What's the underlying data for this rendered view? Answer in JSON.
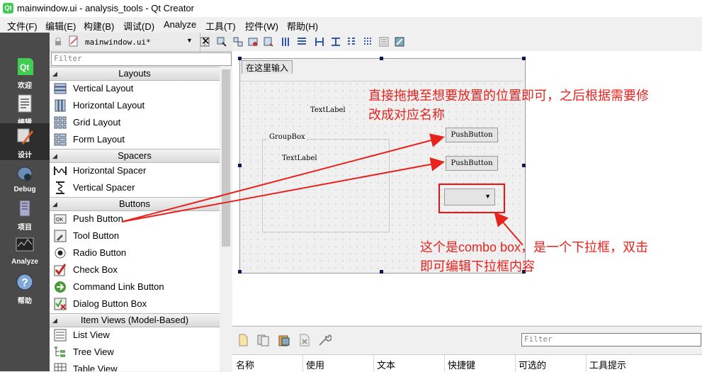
{
  "window": {
    "title": "mainwindow.ui - analysis_tools - Qt Creator",
    "logo_text": "Qt"
  },
  "menubar": [
    {
      "label": "文件(F)"
    },
    {
      "label": "编辑(E)"
    },
    {
      "label": "构建(B)"
    },
    {
      "label": "调试(D)"
    },
    {
      "label": "Analyze"
    },
    {
      "label": "工具(T)"
    },
    {
      "label": "控件(W)"
    },
    {
      "label": "帮助(H)"
    }
  ],
  "modes": [
    {
      "label": "欢迎",
      "icon": "qt-logo-icon"
    },
    {
      "label": "编辑",
      "icon": "edit-document-icon"
    },
    {
      "label": "设计",
      "icon": "design-brush-icon"
    },
    {
      "label": "Debug",
      "icon": "debug-bug-icon"
    },
    {
      "label": "项目",
      "icon": "project-wrench-icon"
    },
    {
      "label": "Analyze",
      "icon": "analyze-monitor-icon"
    },
    {
      "label": "帮助",
      "icon": "help-icon"
    }
  ],
  "editor": {
    "file": "mainwindow.ui*"
  },
  "widgetbox": {
    "filter_placeholder": "Filter",
    "categories": {
      "layouts": "Layouts",
      "spacers": "Spacers",
      "buttons": "Buttons",
      "item_views": "Item Views (Model-Based)"
    },
    "items": {
      "vertical_layout": "Vertical Layout",
      "horizontal_layout": "Horizontal Layout",
      "grid_layout": "Grid Layout",
      "form_layout": "Form Layout",
      "horizontal_spacer": "Horizontal Spacer",
      "vertical_spacer": "Vertical Spacer",
      "push_button": "Push Button",
      "tool_button": "Tool Button",
      "radio_button": "Radio Button",
      "check_box": "Check Box",
      "command_link_button": "Command Link Button",
      "dialog_button_box": "Dialog Button Box",
      "list_view": "List View",
      "tree_view": "Tree View",
      "table_view": "Table View"
    }
  },
  "form": {
    "menu_placeholder": "在这里输入",
    "textlabel_1": "TextLabel",
    "textlabel_2": "TextLabel",
    "groupbox_title": "GroupBox",
    "pushbutton_1": "PushButton",
    "pushbutton_2": "PushButton"
  },
  "annotations": {
    "drag_note_line1": "直接拖拽至想要放置的位置即可，之后根据需要修",
    "drag_note_line2": "改成对应名称",
    "combo_note_line1": "这个是combo box，是一个下拉框，双击",
    "combo_note_line2": "即可编辑下拉框内容",
    "color": "#e8231e"
  },
  "action_editor": {
    "filter_placeholder": "Filter",
    "columns": [
      "名称",
      "使用",
      "文本",
      "快捷键",
      "可选的",
      "工具提示"
    ]
  }
}
